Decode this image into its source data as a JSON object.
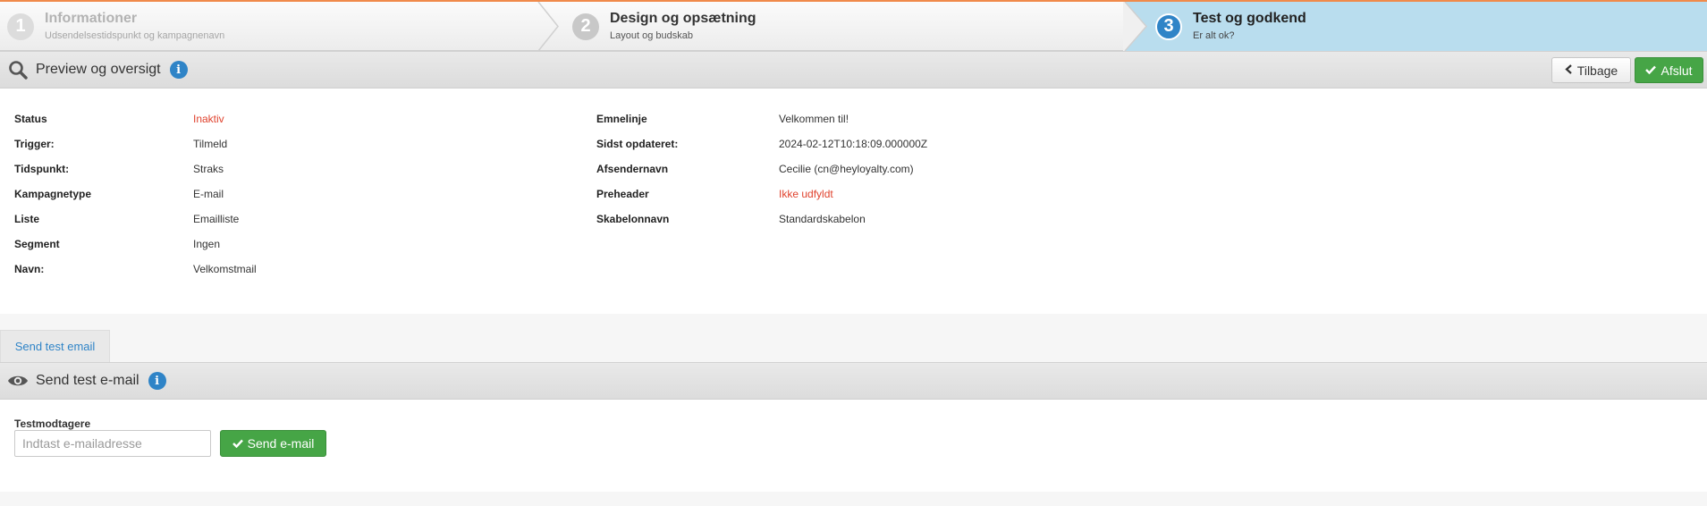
{
  "wizard": {
    "steps": [
      {
        "number": "1",
        "title": "Informationer",
        "subtitle": "Udsendelsestidspunkt og kampagnenavn"
      },
      {
        "number": "2",
        "title": "Design og opsætning",
        "subtitle": "Layout og budskab"
      },
      {
        "number": "3",
        "title": "Test og godkend",
        "subtitle": "Er alt ok?"
      }
    ]
  },
  "preview": {
    "title": "Preview og oversigt",
    "info_glyph": "i",
    "back_label": "Tilbage",
    "finish_label": "Afslut"
  },
  "details": {
    "left": [
      {
        "label": "Status",
        "value": "Inaktiv"
      },
      {
        "label": "Trigger:",
        "value": "Tilmeld"
      },
      {
        "label": "Tidspunkt:",
        "value": "Straks"
      },
      {
        "label": "Kampagnetype",
        "value": "E-mail"
      },
      {
        "label": "Liste",
        "value": "Emailliste"
      },
      {
        "label": "Segment",
        "value": "Ingen"
      },
      {
        "label": "Navn:",
        "value": "Velkomstmail"
      }
    ],
    "right": [
      {
        "label": "Emnelinje",
        "value": "Velkommen til!"
      },
      {
        "label": "Sidst opdateret:",
        "value": "2024-02-12T10:18:09.000000Z"
      },
      {
        "label": "Afsendernavn",
        "value": "Cecilie (cn@heyloyalty.com)"
      },
      {
        "label": "Preheader",
        "value": "Ikke udfyldt"
      },
      {
        "label": "Skabelonnavn",
        "value": "Standardskabelon"
      }
    ]
  },
  "tabs": {
    "send_test": "Send test email"
  },
  "test_section": {
    "title": "Send test e-mail",
    "info_glyph": "i",
    "recipients_label": "Testmodtagere",
    "email_placeholder": "Indtast e-mailadresse",
    "send_label": "Send e-mail"
  },
  "colors": {
    "accent": "#2f84c7",
    "success": "#46a546",
    "warning_text": "#e0432e",
    "active_step_bg": "#b9ddee",
    "top_border": "#f08a4b"
  },
  "icons": {
    "preview": "magnifier-icon",
    "test": "eye-icon",
    "back": "chevron-left-icon",
    "check": "check-icon"
  }
}
